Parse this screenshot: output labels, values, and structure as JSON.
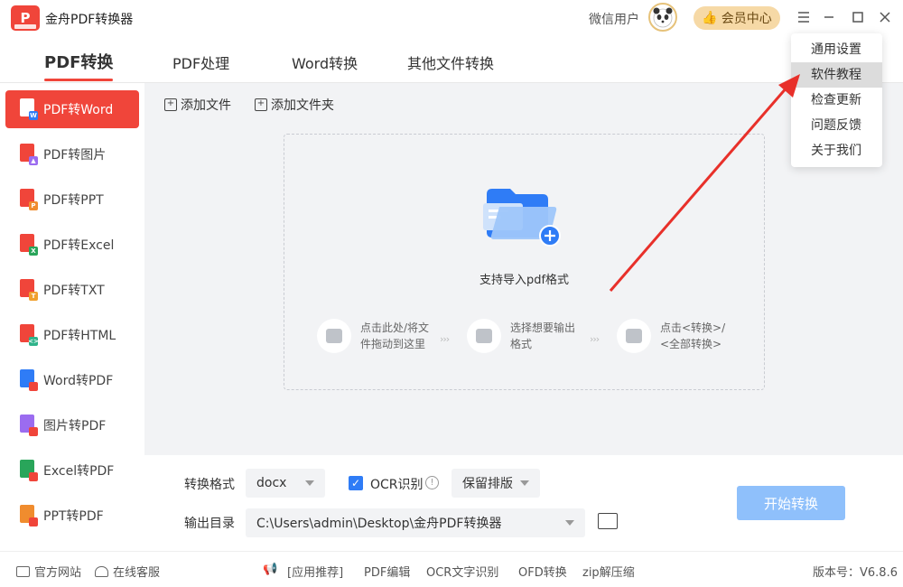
{
  "app": {
    "title": "金舟PDF转换器",
    "logo_letter": "P"
  },
  "header": {
    "user_name": "微信用户",
    "vip_label": "会员中心"
  },
  "tabs": [
    {
      "label": "PDF转换",
      "active": true
    },
    {
      "label": "PDF处理"
    },
    {
      "label": "Word转换"
    },
    {
      "label": "其他文件转换"
    }
  ],
  "sidebar": {
    "items": [
      {
        "label": "PDF转Word",
        "active": true,
        "badge_color": "#2f7cf6",
        "badge": "W"
      },
      {
        "label": "PDF转图片",
        "badge_color": "#9b6cf0",
        "badge": "▲"
      },
      {
        "label": "PDF转PPT",
        "badge_color": "#f08c2e",
        "badge": "P"
      },
      {
        "label": "PDF转Excel",
        "badge_color": "#29a55a",
        "badge": "X"
      },
      {
        "label": "PDF转TXT",
        "badge_color": "#f0a02e",
        "badge": "T"
      },
      {
        "label": "PDF转HTML",
        "badge_color": "#2fb38a",
        "badge": "<>"
      },
      {
        "label": "Word转PDF",
        "badge_color": "#f0453a",
        "badge": ""
      },
      {
        "label": "图片转PDF",
        "badge_color": "#f0453a",
        "badge": ""
      },
      {
        "label": "Excel转PDF",
        "badge_color": "#f0453a",
        "badge": ""
      },
      {
        "label": "PPT转PDF",
        "badge_color": "#f0453a",
        "badge": ""
      }
    ]
  },
  "toolbar": {
    "add_file": "添加文件",
    "add_folder": "添加文件夹"
  },
  "dropzone": {
    "hint": "支持导入pdf格式",
    "steps": [
      {
        "line1": "点击此处/将文",
        "line2": "件拖动到这里"
      },
      {
        "line1": "选择想要输出",
        "line2": "格式"
      },
      {
        "line1": "点击<转换>/",
        "line2": "<全部转换>"
      }
    ],
    "step_arrows": "›››"
  },
  "settings": {
    "format_label": "转换格式",
    "format_value": "docx",
    "ocr_label": "OCR识别",
    "ocr_checked": true,
    "layout_value": "保留排版",
    "output_label": "输出目录",
    "output_path": "C:\\Users\\admin\\Desktop\\金舟PDF转换器",
    "start_label": "开始转换"
  },
  "footer": {
    "official_site": "官方网站",
    "online_service": "在线客服",
    "promo_prefix": "[应用推荐]",
    "promo_items": [
      "PDF编辑",
      "OCR文字识别",
      "OFD转换",
      "zip解压缩"
    ],
    "version": "版本号：V6.8.6"
  },
  "menu": {
    "items": [
      {
        "label": "通用设置"
      },
      {
        "label": "软件教程",
        "hover": true
      },
      {
        "label": "检查更新"
      },
      {
        "label": "问题反馈"
      },
      {
        "label": "关于我们"
      }
    ]
  },
  "colors": {
    "accent": "#f0453a",
    "primary_blue": "#2f7cf6",
    "start_button": "#8fc0fb",
    "arrow": "#e8302a"
  }
}
